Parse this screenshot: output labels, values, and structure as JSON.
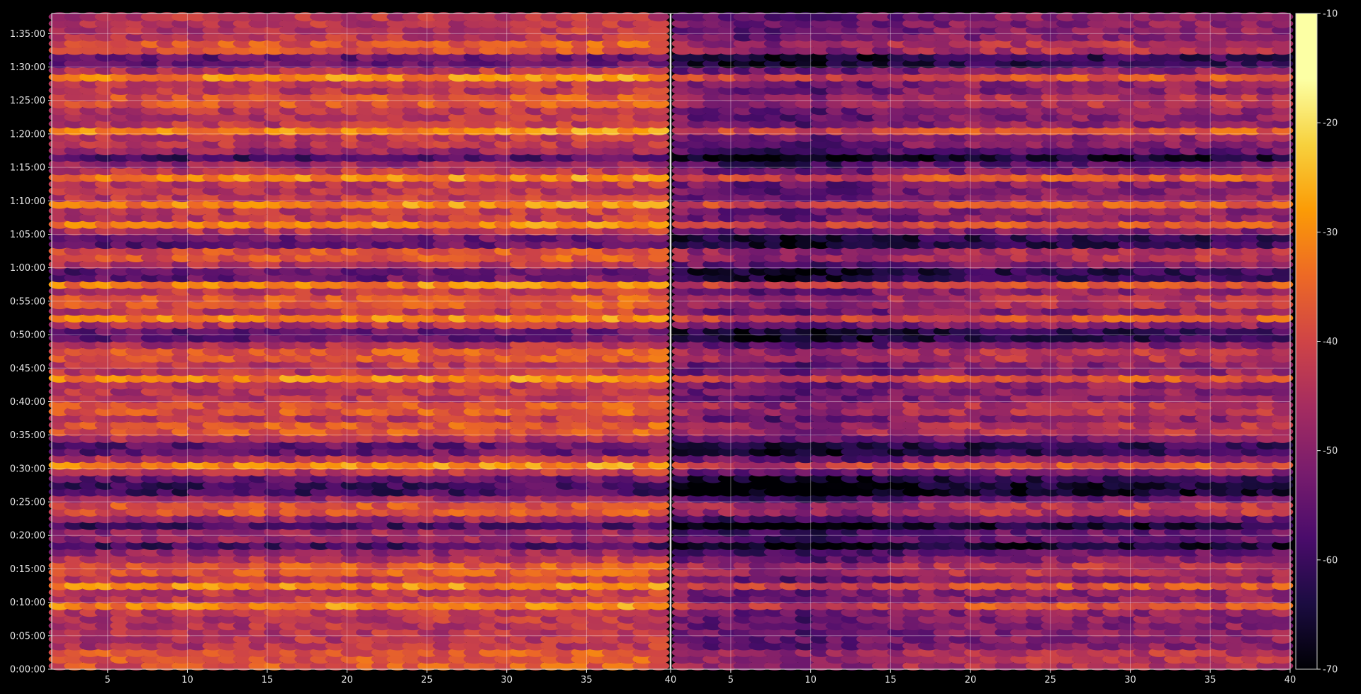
{
  "chart_data": {
    "type": "heatmap",
    "title": "",
    "xlabel": "",
    "ylabel": "",
    "panels": [
      {
        "name": "",
        "x_ticks": [
          5,
          10,
          15,
          20,
          25,
          30,
          35,
          40
        ],
        "xlim": [
          1.5,
          40
        ]
      },
      {
        "name": "",
        "x_ticks": [
          5,
          10,
          15,
          20,
          25,
          30,
          35,
          40
        ],
        "xlim": [
          1.5,
          40
        ]
      }
    ],
    "panel_split_tick_label": "40",
    "y_ticks": [
      "0:00:00",
      "0:05:00",
      "0:10:00",
      "0:15:00",
      "0:20:00",
      "0:25:00",
      "0:30:00",
      "0:35:00",
      "0:40:00",
      "0:45:00",
      "0:50:00",
      "0:55:00",
      "1:00:00",
      "1:05:00",
      "1:10:00",
      "1:15:00",
      "1:20:00",
      "1:25:00",
      "1:30:00",
      "1:35:00"
    ],
    "ylim_seconds": [
      0,
      5880
    ],
    "colorbar": {
      "colormap": "inferno",
      "range": [
        -70,
        -10
      ],
      "ticks": [
        "-10",
        "-20",
        "-30",
        "-40",
        "-50",
        "-60",
        "-70"
      ]
    },
    "grid": true,
    "background": "#000000",
    "bright_bands_time": [
      "0:00:00",
      "0:02:00",
      "0:09:30",
      "0:12:30",
      "0:15:00",
      "0:24:00",
      "0:30:30",
      "0:36:00",
      "0:39:00",
      "0:43:30",
      "0:47:00",
      "0:52:30",
      "0:55:00",
      "0:57:30",
      "1:02:00",
      "1:06:30",
      "1:09:30",
      "1:13:30",
      "1:20:30",
      "1:25:00",
      "1:28:30",
      "1:33:00"
    ],
    "dark_bands_time": [
      "0:18:30",
      "0:21:30",
      "0:26:30",
      "0:28:00",
      "0:33:00",
      "0:50:00",
      "0:59:00",
      "1:04:00",
      "1:16:30",
      "1:31:00"
    ]
  }
}
